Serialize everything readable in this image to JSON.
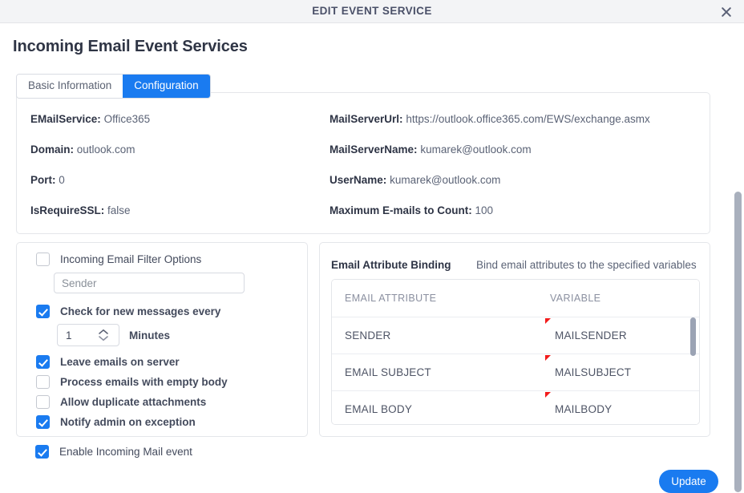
{
  "window": {
    "title": "EDIT EVENT SERVICE",
    "close_icon": "close-icon"
  },
  "page": {
    "heading": "Incoming Email Event Services"
  },
  "tabs": [
    {
      "label": "Basic Information",
      "active": false
    },
    {
      "label": "Configuration",
      "active": true
    }
  ],
  "info": {
    "left": [
      {
        "label": "EMailService:",
        "value": "Office365"
      },
      {
        "label": "Domain:",
        "value": "outlook.com"
      },
      {
        "label": "Port:",
        "value": "0"
      },
      {
        "label": "IsRequireSSL:",
        "value": "false"
      }
    ],
    "right": [
      {
        "label": "MailServerUrl:",
        "value": "https://outlook.office365.com/EWS/exchange.asmx"
      },
      {
        "label": "MailServerName:",
        "value": "kumarek@outlook.com"
      },
      {
        "label": "UserName:",
        "value": "kumarek@outlook.com"
      },
      {
        "label": "Maximum E-mails to Count:",
        "value": "100"
      }
    ]
  },
  "filter_panel": {
    "filter_options_label": "Incoming Email Filter Options",
    "filter_options_checked": false,
    "sender_placeholder": "Sender",
    "sender_value": "",
    "check_new_label": "Check for new messages every",
    "check_new_checked": true,
    "interval_value": "1",
    "minutes_label": "Minutes",
    "options": [
      {
        "label": "Leave emails on server",
        "checked": true
      },
      {
        "label": "Process emails with empty body",
        "checked": false
      },
      {
        "label": "Allow duplicate attachments",
        "checked": false
      },
      {
        "label": "Notify admin on exception",
        "checked": true
      }
    ]
  },
  "binding_panel": {
    "title": "Email Attribute Binding",
    "subtitle": "Bind email attributes to the specified variables",
    "columns": [
      "EMAIL ATTRIBUTE",
      "VARIABLE"
    ],
    "rows": [
      {
        "attribute": "SENDER",
        "variable": "MAILSENDER"
      },
      {
        "attribute": "EMAIL SUBJECT",
        "variable": "MAILSUBJECT"
      },
      {
        "attribute": "EMAIL BODY",
        "variable": "MAILBODY"
      }
    ]
  },
  "footer": {
    "enable_label": "Enable Incoming Mail event",
    "enable_checked": true,
    "update_label": "Update"
  },
  "colors": {
    "accent": "#1a7bf0",
    "flag": "#f21b1b",
    "titlebar_bg": "#f3f4f6",
    "label_text": "#2e3445",
    "value_text": "#5b6376"
  }
}
